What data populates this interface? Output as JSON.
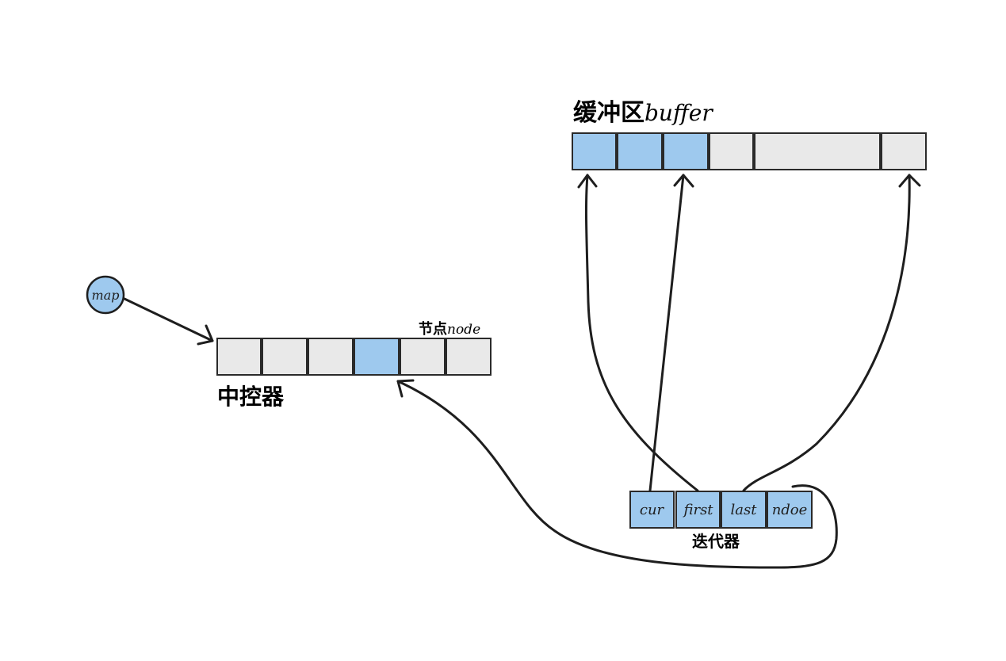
{
  "colors": {
    "highlight": "#9ec9ee",
    "empty": "#e9e9e9",
    "stroke": "#1e1e1e"
  },
  "buffer": {
    "title_cn": "缓冲区",
    "title_en": "buffer",
    "cells_highlighted": [
      true,
      true,
      true,
      false,
      false,
      false
    ]
  },
  "map_array": {
    "label": "中控器",
    "node_label_cn": "节点",
    "node_label_en": "node",
    "cells_highlighted": [
      false,
      false,
      false,
      true,
      false,
      false
    ]
  },
  "map_pointer": {
    "label": "map"
  },
  "iterator": {
    "label": "迭代器",
    "fields": [
      "cur",
      "first",
      "last",
      "ndoe"
    ]
  }
}
